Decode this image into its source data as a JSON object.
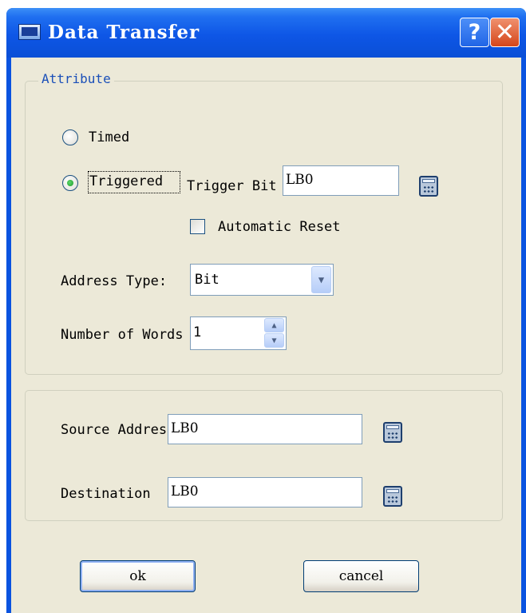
{
  "window": {
    "title": "Data Transfer"
  },
  "titlebar": {
    "help_label": "?",
    "close_label": "✕"
  },
  "attribute": {
    "group_title": "Attribute",
    "timed_label": "Timed",
    "triggered_label": "Triggered",
    "mode_selected": "Triggered",
    "trigger_bit_label": "Trigger Bit",
    "trigger_bit_value": "LB0",
    "automatic_reset_label": "Automatic Reset",
    "automatic_reset_checked": false,
    "address_type_label": "Address Type:",
    "address_type_value": "Bit",
    "number_of_words_label": "Number of Words",
    "number_of_words_value": "1"
  },
  "addresses": {
    "source_label": "Source Address",
    "source_value": "LB0",
    "destination_label": "Destination",
    "destination_value": "LB0"
  },
  "buttons": {
    "ok_label": "ok",
    "cancel_label": "cancel"
  },
  "icons": {
    "app": "window-app-icon",
    "calculator": "calculator-icon",
    "dropdown": "chevron-down-icon",
    "spin_up": "arrow-up-icon",
    "spin_down": "arrow-down-icon"
  },
  "colors": {
    "titlebar": "#0a53e0",
    "dialog_background": "#ece9d8",
    "group_title": "#1a4fb8",
    "close_button": "#d4461b"
  }
}
